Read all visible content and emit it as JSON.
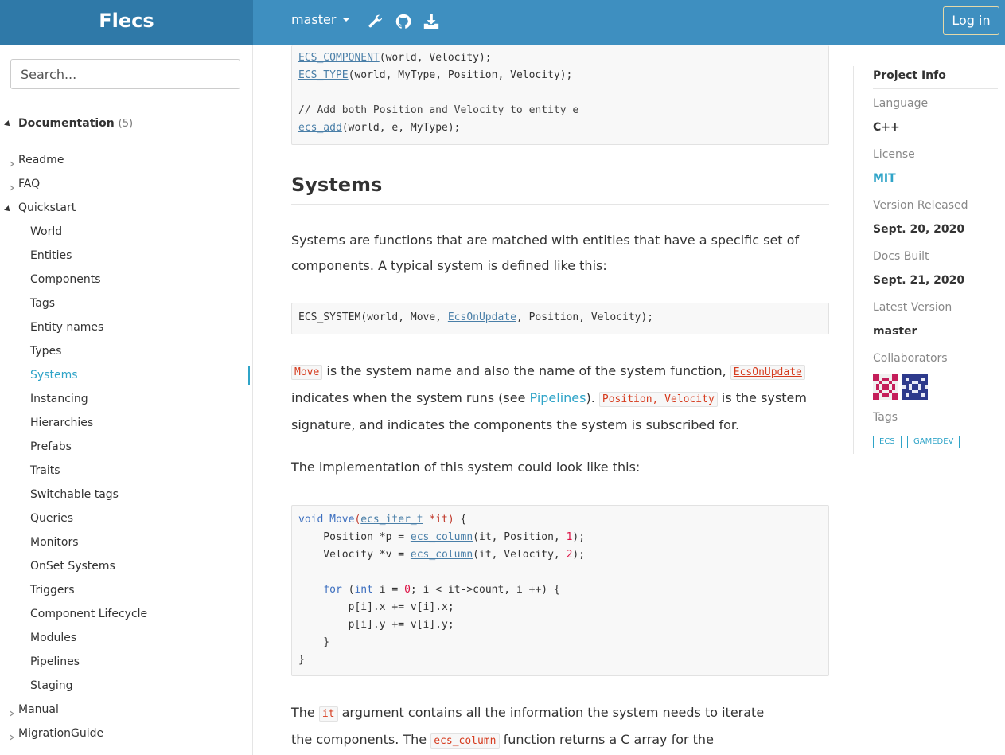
{
  "header": {
    "brand": "Flecs",
    "branch": "master",
    "icons": [
      "wrench-icon",
      "github-icon",
      "download-icon"
    ],
    "login_label": "Log in",
    "colors": {
      "bar": "#3e8fc0",
      "brand_bg": "#2f79a8",
      "accent": "#2fa4c8"
    }
  },
  "sidebar": {
    "search_placeholder": "Search...",
    "section": {
      "label": "Documentation",
      "count": "(5)"
    },
    "items": [
      {
        "label": "Readme",
        "level": "top",
        "expandable": true
      },
      {
        "label": "FAQ",
        "level": "top",
        "expandable": true
      },
      {
        "label": "Quickstart",
        "level": "top",
        "expanded": true
      },
      {
        "label": "World",
        "level": "sub"
      },
      {
        "label": "Entities",
        "level": "sub"
      },
      {
        "label": "Components",
        "level": "sub"
      },
      {
        "label": "Tags",
        "level": "sub"
      },
      {
        "label": "Entity names",
        "level": "sub"
      },
      {
        "label": "Types",
        "level": "sub"
      },
      {
        "label": "Systems",
        "level": "sub",
        "active": true
      },
      {
        "label": "Instancing",
        "level": "sub"
      },
      {
        "label": "Hierarchies",
        "level": "sub"
      },
      {
        "label": "Prefabs",
        "level": "sub"
      },
      {
        "label": "Traits",
        "level": "sub"
      },
      {
        "label": "Switchable tags",
        "level": "sub"
      },
      {
        "label": "Queries",
        "level": "sub"
      },
      {
        "label": "Monitors",
        "level": "sub"
      },
      {
        "label": "OnSet Systems",
        "level": "sub"
      },
      {
        "label": "Triggers",
        "level": "sub"
      },
      {
        "label": "Component Lifecycle",
        "level": "sub"
      },
      {
        "label": "Modules",
        "level": "sub"
      },
      {
        "label": "Pipelines",
        "level": "sub"
      },
      {
        "label": "Staging",
        "level": "sub"
      },
      {
        "label": "Manual",
        "level": "top",
        "expandable": true
      },
      {
        "label": "MigrationGuide",
        "level": "top",
        "expandable": true
      }
    ]
  },
  "content": {
    "code1": {
      "l1_fn": "ECS_COMPONENT",
      "l1_rest": "(world, Velocity);",
      "l2_fn": "ECS_TYPE",
      "l2_rest": "(world, MyType, Position, Velocity);",
      "l4": "// Add both Position and Velocity to entity e",
      "l5_fn": "ecs_add",
      "l5_rest": "(world, e, MyType);"
    },
    "heading": "Systems",
    "p1": "Systems are functions that are matched with entities that have a specific set of components. A typical system is defined like this:",
    "code2": {
      "a": "ECS_SYSTEM(world, Move, ",
      "link": "EcsOnUpdate",
      "b": ", Position, Velocity);"
    },
    "p2": {
      "code_move": "Move",
      "t1": " is the system name and also the name of the system function, ",
      "code_onupdate": "EcsOnUpdate",
      "t2": "indicates when the system runs (see ",
      "link_pipelines": "Pipelines",
      "t3": "). ",
      "code_sig": "Position, Velocity",
      "t4": " is the system signature, and indicates the components the system is subscribed for."
    },
    "p3": "The implementation of this system could look like this:",
    "code3": {
      "void": "void",
      "move": "Move",
      "paren": "(",
      "iter": "ecs_iter_t",
      "it": " *it)",
      "brace": " {",
      "pos_a": "    Position *p = ",
      "col": "ecs_column",
      "pos_b": "(it, Position, ",
      "one": "1",
      "end": ");",
      "vel_a": "    Velocity *v = ",
      "vel_b": "(it, Velocity, ",
      "two": "2",
      "for": "for",
      "for_a": " (",
      "int": "int",
      "for_b": " i = ",
      "zero": "0",
      "for_c": "; i < it->count, i ++) {",
      "px": "        p[i].x += v[i].x;",
      "py": "        p[i].y += v[i].y;",
      "close_in": "    }",
      "close_out": "}"
    },
    "p4": {
      "t1": "The ",
      "code_it": "it",
      "t2": " argument contains all the information the system needs to iterate the components. The ",
      "code_col": "ecs_column",
      "t3": " function returns a C array for the subscribed for"
    }
  },
  "info": {
    "title": "Project Info",
    "language_label": "Language",
    "language": "C++",
    "license_label": "License",
    "license": "MIT",
    "released_label": "Version Released",
    "released": "Sept. 20, 2020",
    "built_label": "Docs Built",
    "built": "Sept. 21, 2020",
    "latest_label": "Latest Version",
    "latest": "master",
    "collab_label": "Collaborators",
    "tags_label": "Tags",
    "tags": [
      "ECS",
      "GAMEDEV"
    ]
  }
}
